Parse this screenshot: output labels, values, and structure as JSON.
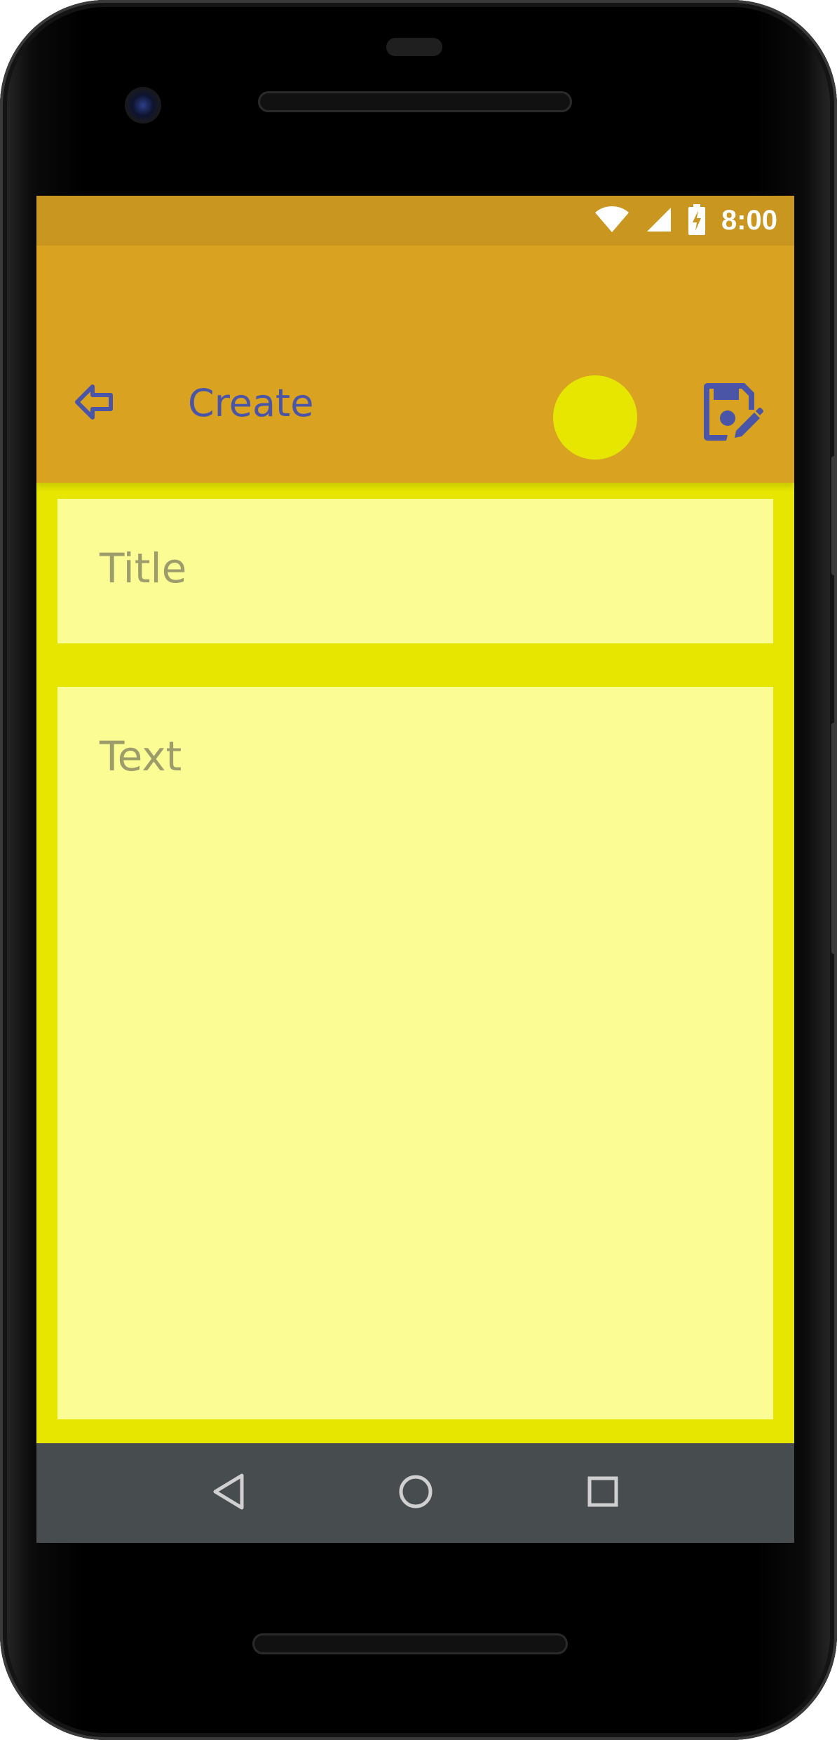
{
  "status_bar": {
    "time": "8:00",
    "icons": [
      "wifi-icon",
      "signal-icon",
      "battery-charging-icon"
    ]
  },
  "app_bar": {
    "title": "Create",
    "back_icon": "back-arrow-icon",
    "color_picker_color": "#e6e600",
    "save_icon": "save-edit-icon"
  },
  "form": {
    "title_placeholder": "Title",
    "text_placeholder": "Text"
  },
  "nav_bar": {
    "buttons": [
      "back-triangle-icon",
      "home-circle-icon",
      "recents-square-icon"
    ]
  },
  "colors": {
    "status_bar": "#c99620",
    "app_bar": "#d9a321",
    "accent": "#4a55a8",
    "note_background": "#e6e600",
    "field_background": "#fcfc94",
    "nav_bar": "#474c4f"
  }
}
